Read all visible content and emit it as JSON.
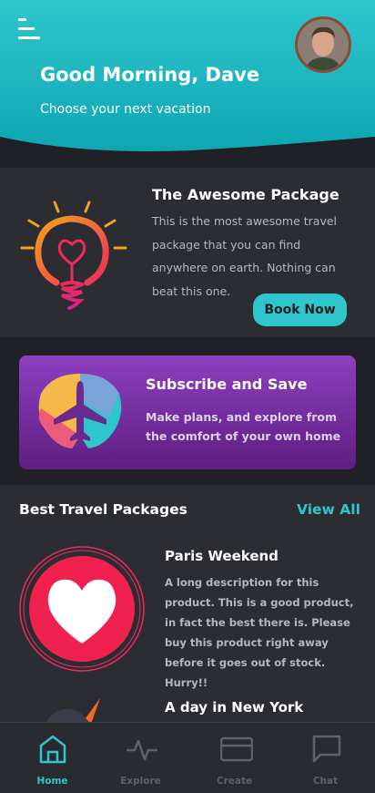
{
  "header": {
    "greeting": "Good Morning, Dave",
    "subtitle": "Choose your next vacation",
    "gradient_top": "#2ec6cc",
    "gradient_bottom": "#0fa6b4"
  },
  "featured": {
    "title": "The Awesome Package",
    "description": "This is the most awesome travel package that you can find anywhere on earth. Nothing can beat this one.",
    "button_label": "Book Now",
    "icon": "lightbulb-heart-icon"
  },
  "subscribe": {
    "title": "Subscribe and Save",
    "description": "Make plans, and explore from the comfort of your own home",
    "icon": "airplane-globe-icon"
  },
  "best_packages": {
    "heading": "Best Travel Packages",
    "view_all_label": "View All",
    "items": [
      {
        "title": "Paris Weekend",
        "description": "A long description for this product. This is a good product, in fact the best there is. Please buy this product right away before it goes out of stock. Hurry!!",
        "icon": "heart-icon"
      },
      {
        "title": "A day in New York",
        "icon": "rocket-icon"
      }
    ]
  },
  "nav": {
    "items": [
      {
        "label": "Home",
        "icon": "home-icon",
        "active": true
      },
      {
        "label": "Explore",
        "icon": "activity-icon",
        "active": false
      },
      {
        "label": "Create",
        "icon": "card-icon",
        "active": false
      },
      {
        "label": "Chat",
        "icon": "chat-icon",
        "active": false
      }
    ]
  },
  "colors": {
    "accent": "#2ec6cc",
    "background": "#1f2126",
    "card": "#2b2d33",
    "subscribe_top": "#8e3fc0",
    "subscribe_bottom": "#5e1f80"
  }
}
